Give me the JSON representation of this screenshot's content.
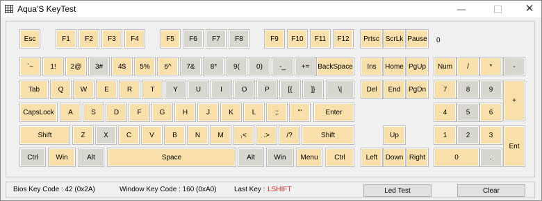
{
  "window": {
    "title": "Aqua'S KeyTest",
    "min_glyph": "—",
    "close_glyph": "✕"
  },
  "colors": {
    "key_highlight": "#f9e0aa",
    "key_normal": "#d7d6cf",
    "last_key": "#ee2222"
  },
  "keyboard": {
    "last_code": "0",
    "row_fn": [
      {
        "label": "Esc",
        "state": "y"
      },
      {
        "label": "F1",
        "state": "y"
      },
      {
        "label": "F2",
        "state": "y"
      },
      {
        "label": "F3",
        "state": "y"
      },
      {
        "label": "F4",
        "state": "y"
      },
      {
        "label": "F5",
        "state": "y"
      },
      {
        "label": "F6",
        "state": "g"
      },
      {
        "label": "F7",
        "state": "g"
      },
      {
        "label": "F8",
        "state": "g"
      },
      {
        "label": "F9",
        "state": "y"
      },
      {
        "label": "F10",
        "state": "y"
      },
      {
        "label": "F11",
        "state": "y"
      },
      {
        "label": "F12",
        "state": "y"
      },
      {
        "label": "Prtsc",
        "state": "y"
      },
      {
        "label": "ScrLk",
        "state": "y"
      },
      {
        "label": "Pause",
        "state": "y"
      }
    ],
    "row_num": [
      {
        "label": "`~",
        "state": "y"
      },
      {
        "label": "1!",
        "state": "y"
      },
      {
        "label": "2@",
        "state": "y"
      },
      {
        "label": "3#",
        "state": "g"
      },
      {
        "label": "4$",
        "state": "y"
      },
      {
        "label": "5%",
        "state": "y"
      },
      {
        "label": "6^",
        "state": "y"
      },
      {
        "label": "7&",
        "state": "g"
      },
      {
        "label": "8*",
        "state": "g"
      },
      {
        "label": "9(",
        "state": "g"
      },
      {
        "label": "0)",
        "state": "g"
      },
      {
        "label": "-_",
        "state": "g"
      },
      {
        "label": "+=",
        "state": "g"
      },
      {
        "label": "BackSpace",
        "state": "y"
      },
      {
        "label": "Ins",
        "state": "y"
      },
      {
        "label": "Home",
        "state": "y"
      },
      {
        "label": "PgUp",
        "state": "y"
      },
      {
        "label": "Num",
        "state": "y"
      },
      {
        "label": "/",
        "state": "y"
      },
      {
        "label": "*",
        "state": "y"
      },
      {
        "label": "-",
        "state": "g"
      }
    ],
    "row_tab": [
      {
        "label": "Tab",
        "state": "y"
      },
      {
        "label": "Q",
        "state": "y"
      },
      {
        "label": "W",
        "state": "y"
      },
      {
        "label": "E",
        "state": "y"
      },
      {
        "label": "R",
        "state": "y"
      },
      {
        "label": "T",
        "state": "y"
      },
      {
        "label": "Y",
        "state": "g"
      },
      {
        "label": "U",
        "state": "g"
      },
      {
        "label": "I",
        "state": "g"
      },
      {
        "label": "O",
        "state": "g"
      },
      {
        "label": "P",
        "state": "g"
      },
      {
        "label": "[{",
        "state": "g"
      },
      {
        "label": "]}",
        "state": "g"
      },
      {
        "label": "\\|",
        "state": "g"
      },
      {
        "label": "Del",
        "state": "y"
      },
      {
        "label": "End",
        "state": "y"
      },
      {
        "label": "PgDn",
        "state": "y"
      },
      {
        "label": "7",
        "state": "y"
      },
      {
        "label": "8",
        "state": "g"
      },
      {
        "label": "9",
        "state": "g"
      },
      {
        "label": "+",
        "state": "y"
      }
    ],
    "row_caps": [
      {
        "label": "CapsLock",
        "state": "y"
      },
      {
        "label": "A",
        "state": "y"
      },
      {
        "label": "S",
        "state": "y"
      },
      {
        "label": "D",
        "state": "y"
      },
      {
        "label": "F",
        "state": "y"
      },
      {
        "label": "G",
        "state": "y"
      },
      {
        "label": "H",
        "state": "y"
      },
      {
        "label": "J",
        "state": "y"
      },
      {
        "label": "K",
        "state": "y"
      },
      {
        "label": "L",
        "state": "y"
      },
      {
        "label": ";:",
        "state": "y"
      },
      {
        "label": "'\"",
        "state": "y"
      },
      {
        "label": "Enter",
        "state": "y"
      },
      {
        "label": "4",
        "state": "y"
      },
      {
        "label": "5",
        "state": "g"
      },
      {
        "label": "6",
        "state": "y"
      }
    ],
    "row_shift": [
      {
        "label": "Shift",
        "state": "y"
      },
      {
        "label": "Z",
        "state": "y"
      },
      {
        "label": "X",
        "state": "g"
      },
      {
        "label": "C",
        "state": "y"
      },
      {
        "label": "V",
        "state": "y"
      },
      {
        "label": "B",
        "state": "y"
      },
      {
        "label": "N",
        "state": "y"
      },
      {
        "label": "M",
        "state": "y"
      },
      {
        "label": ",<",
        "state": "y"
      },
      {
        "label": ".>",
        "state": "y"
      },
      {
        "label": "/?",
        "state": "y"
      },
      {
        "label": "Shift",
        "state": "y"
      },
      {
        "label": "Up",
        "state": "y"
      },
      {
        "label": "1",
        "state": "y"
      },
      {
        "label": "2",
        "state": "g"
      },
      {
        "label": "3",
        "state": "y"
      },
      {
        "label": "Ent",
        "state": "y"
      }
    ],
    "row_ctrl": [
      {
        "label": "Ctrl",
        "state": "g"
      },
      {
        "label": "Win",
        "state": "y"
      },
      {
        "label": "Alt",
        "state": "g"
      },
      {
        "label": "Space",
        "state": "y"
      },
      {
        "label": "Alt",
        "state": "g"
      },
      {
        "label": "Win",
        "state": "g"
      },
      {
        "label": "Menu",
        "state": "y"
      },
      {
        "label": "Ctrl",
        "state": "y"
      },
      {
        "label": "Left",
        "state": "y"
      },
      {
        "label": "Down",
        "state": "y"
      },
      {
        "label": "Right",
        "state": "y"
      },
      {
        "label": "0",
        "state": "y"
      },
      {
        "label": ".",
        "state": "g"
      }
    ]
  },
  "status": {
    "bios_code": "Bios Key Code : 42 (0x2A)",
    "window_code": "Window Key Code : 160 (0xA0)",
    "last_key_label": "Last Key :",
    "last_key_value": "LSHIFT",
    "led_test": "Led Test",
    "clear": "Clear"
  }
}
